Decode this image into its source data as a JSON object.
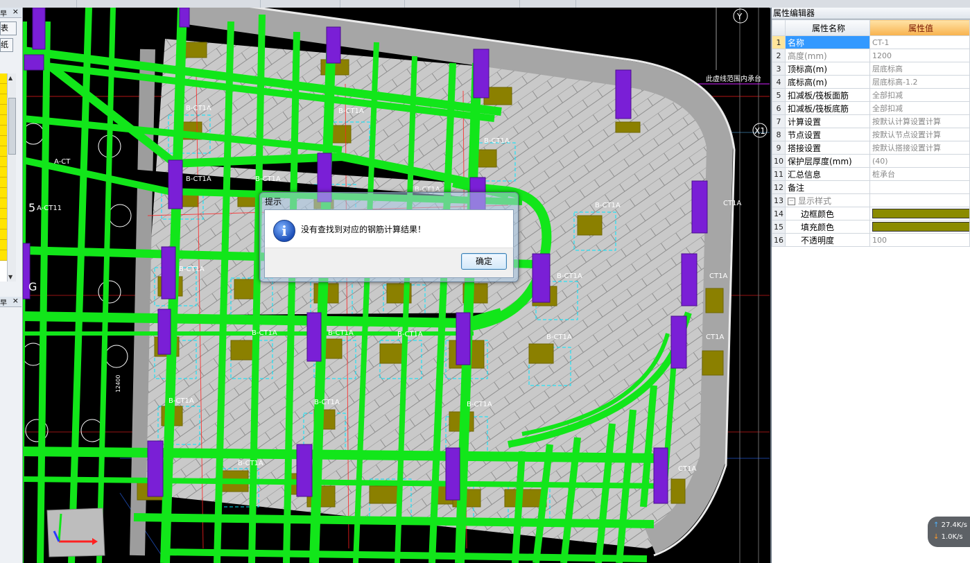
{
  "left_panel": {
    "header_top": "早",
    "tab_label": "表",
    "tab_label2": "纸",
    "header_bottom": "早",
    "close_glyph": "×"
  },
  "viewport": {
    "axis_y_label": "Y",
    "axis_x1_label": "X1",
    "boundary_note": "此虚线范围内承台",
    "tags": {
      "a_ct": "A-CT",
      "a_ct11": "A-CT11",
      "left_num": "5",
      "left_g": "G",
      "b_ct1a": "B-CT1A",
      "ct1a": "CT1A",
      "dim": "12400"
    },
    "colors": {
      "rebar_green": "#12e61a",
      "column_purple": "#7a1fd6",
      "wall_grey": "#a9a9a9",
      "slab_grey": "#c8c8c8",
      "pile_olive": "#8b8000"
    }
  },
  "dialog": {
    "title": "提示",
    "message": "没有查找到对应的钢筋计算结果！",
    "ok_label": "确定",
    "icon": "info-icon"
  },
  "properties": {
    "panel_title": "属性编辑器",
    "col_name": "属性名称",
    "col_value": "属性值",
    "rows": [
      {
        "num": "1",
        "name": "名称",
        "value": "CT-1"
      },
      {
        "num": "2",
        "name": "高度(mm)",
        "value": "1200"
      },
      {
        "num": "3",
        "name": "顶标高(m)",
        "value": "层底标高"
      },
      {
        "num": "4",
        "name": "底标高(m)",
        "value": "层底标高-1.2"
      },
      {
        "num": "5",
        "name": "扣减板/筏板面筋",
        "value": "全部扣减"
      },
      {
        "num": "6",
        "name": "扣减板/筏板底筋",
        "value": "全部扣减"
      },
      {
        "num": "7",
        "name": "计算设置",
        "value": "按默认计算设置计算"
      },
      {
        "num": "8",
        "name": "节点设置",
        "value": "按默认节点设置计算"
      },
      {
        "num": "9",
        "name": "搭接设置",
        "value": "按默认搭接设置计算"
      },
      {
        "num": "10",
        "name": "保护层厚度(mm)",
        "value": "(40)"
      },
      {
        "num": "11",
        "name": "汇总信息",
        "value": "桩承台"
      },
      {
        "num": "12",
        "name": "备注",
        "value": ""
      },
      {
        "num": "13",
        "name": "显示样式",
        "value": ""
      },
      {
        "num": "14",
        "name": "边框颜色",
        "value": ""
      },
      {
        "num": "15",
        "name": "填充颜色",
        "value": ""
      },
      {
        "num": "16",
        "name": "不透明度",
        "value": "100"
      }
    ],
    "border_color": "#8b8b00",
    "fill_color": "#8b8b00"
  },
  "speed_meter": {
    "upload": "27.4K/s",
    "download": "1.0K/s"
  }
}
